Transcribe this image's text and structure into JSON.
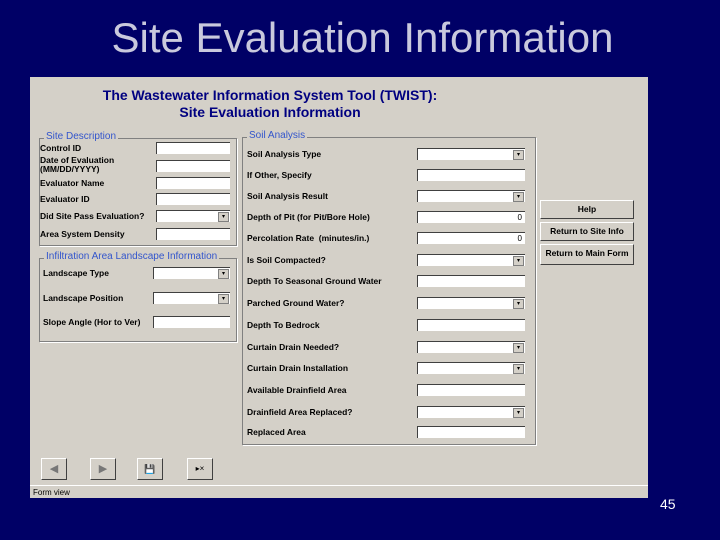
{
  "slide": {
    "title": "Site Evaluation Information",
    "page_number": "45"
  },
  "form": {
    "header_line1": "The Wastewater Information System Tool (TWIST):",
    "header_line2": "Site Evaluation Information",
    "status": "Form view"
  },
  "site_description": {
    "legend": "Site Description",
    "fields": [
      {
        "label": "Control ID",
        "value": "",
        "dropdown": false
      },
      {
        "label": "Date of Evaluation\n(MM/DD/YYYY)",
        "value": "",
        "dropdown": false
      },
      {
        "label": "Evaluator Name",
        "value": "",
        "dropdown": false
      },
      {
        "label": "Evaluator ID",
        "value": "",
        "dropdown": false
      },
      {
        "label": "Did Site Pass Evaluation?",
        "value": "",
        "dropdown": true
      },
      {
        "label": "Area System Density",
        "value": "",
        "dropdown": false
      }
    ]
  },
  "infiltration": {
    "legend": "Infiltration Area Landscape Information",
    "fields": [
      {
        "label": "Landscape Type",
        "value": "",
        "dropdown": true
      },
      {
        "label": "Landscape Position",
        "value": "",
        "dropdown": true
      },
      {
        "label": "Slope Angle (Hor to Ver)",
        "value": "",
        "dropdown": false
      }
    ]
  },
  "soil_analysis": {
    "legend": "Soil Analysis",
    "fields": [
      {
        "label": "Soil Analysis Type",
        "value": "",
        "dropdown": true
      },
      {
        "label": "If Other, Specify",
        "value": "",
        "dropdown": false
      },
      {
        "label": "Soil Analysis Result",
        "value": "",
        "dropdown": true
      },
      {
        "label": "Depth of Pit (for Pit/Bore Hole)",
        "value": "0",
        "dropdown": false
      },
      {
        "label": "Percolation Rate  (minutes/in.)",
        "value": "0",
        "dropdown": false
      },
      {
        "label": "Is Soil Compacted?",
        "value": "",
        "dropdown": true
      },
      {
        "label": "Depth To Seasonal Ground Water",
        "value": "",
        "dropdown": false
      },
      {
        "label": "Parched Ground Water?",
        "value": "",
        "dropdown": true
      },
      {
        "label": "Depth To Bedrock",
        "value": "",
        "dropdown": false
      },
      {
        "label": "Curtain Drain Needed?",
        "value": "",
        "dropdown": true
      },
      {
        "label": "Curtain Drain Installation",
        "value": "",
        "dropdown": true
      },
      {
        "label": "Available Drainfield Area",
        "value": "",
        "dropdown": false
      },
      {
        "label": "Drainfield Area Replaced?",
        "value": "",
        "dropdown": true
      },
      {
        "label": "Replaced Area",
        "value": "",
        "dropdown": false
      }
    ]
  },
  "buttons": {
    "help": "Help",
    "site_info": "Return to Site Info",
    "main_form": "Return to Main Form"
  },
  "nav": {
    "prev": "◀",
    "next": "▶",
    "save": "💾",
    "close": "▸×"
  }
}
